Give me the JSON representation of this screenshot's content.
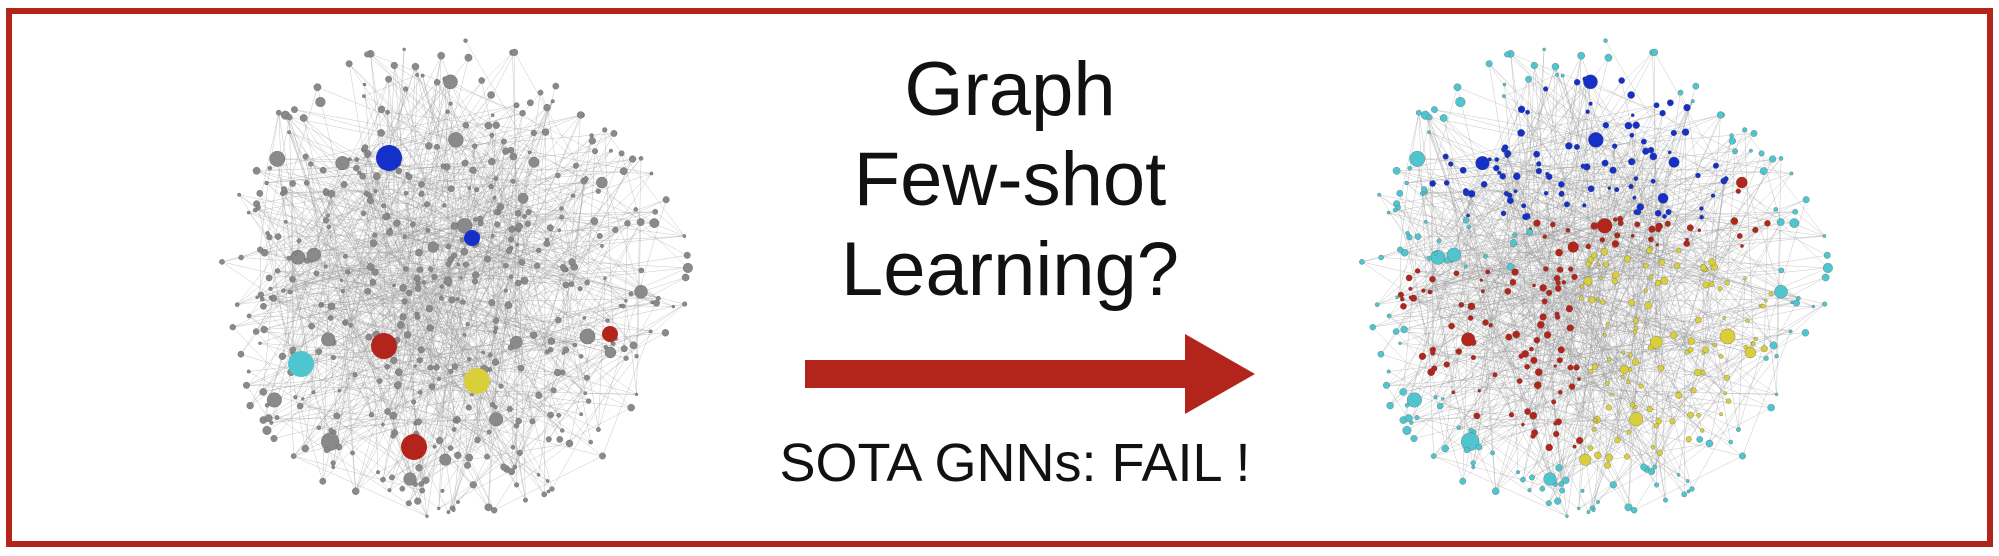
{
  "title_lines": [
    "Graph",
    "Few-shot",
    "Learning?"
  ],
  "caption": "SOTA GNNs: FAIL !",
  "colors": {
    "frame": "#b3241a",
    "arrow": "#b3241a",
    "unlabeled_node": "#8a8a8a",
    "edge": "#9a9a9a",
    "class_blue": "#1430c8",
    "class_cyan": "#4fc6cf",
    "class_red": "#b3241a",
    "class_yellow": "#d9cf3a"
  },
  "left_graph": {
    "description_nodes": "unlabeled graph with few labeled nodes",
    "labeled_nodes": [
      {
        "class": "blue"
      },
      {
        "class": "blue"
      },
      {
        "class": "red"
      },
      {
        "class": "red"
      },
      {
        "class": "red"
      },
      {
        "class": "cyan"
      },
      {
        "class": "yellow"
      }
    ]
  },
  "right_graph": {
    "classes": [
      "blue",
      "cyan",
      "red",
      "yellow"
    ]
  }
}
